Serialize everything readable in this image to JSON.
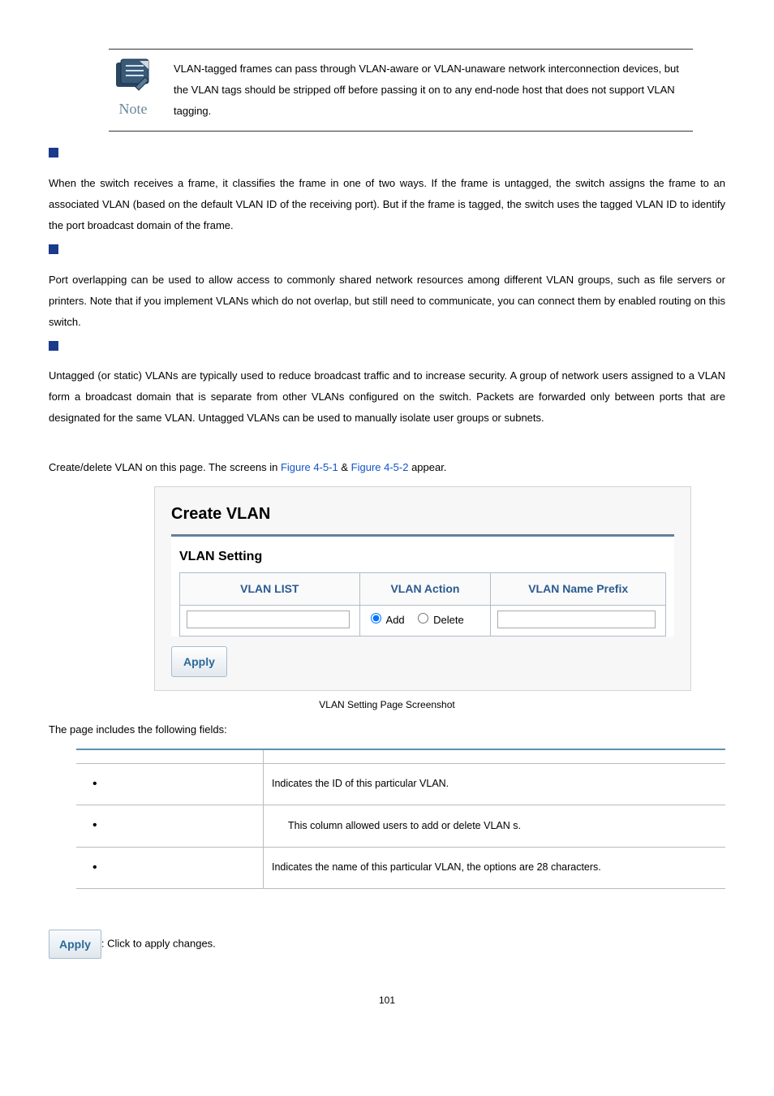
{
  "note": {
    "label": "Note",
    "text": "VLAN-tagged frames can pass through VLAN-aware or VLAN-unaware network interconnection devices, but the VLAN tags should be stripped off before passing it on to any end-node host that does not support VLAN tagging."
  },
  "section1": {
    "text": "When the switch receives a frame, it classifies the frame in one of two ways. If the frame is untagged, the switch assigns the frame to an associated VLAN (based on the default VLAN ID of the receiving port). But if the frame is tagged, the switch uses the tagged VLAN ID to identify the port broadcast domain of the frame."
  },
  "section2": {
    "text": "Port overlapping can be used to allow access to commonly shared network resources among different VLAN groups, such as file servers or printers. Note that if you implement VLANs which do not overlap, but still need to communicate, you can connect them by enabled routing on this switch."
  },
  "section3": {
    "text": "Untagged (or static) VLANs are typically used to reduce broadcast traffic and to increase security. A group of network users assigned to a VLAN form a broadcast domain that is separate from other VLANs configured on the switch. Packets are forwarded only between ports that are designated for the same VLAN. Untagged VLANs can be used to manually isolate user groups or subnets."
  },
  "intro_line_1": "Create/delete VLAN on this page. The screens in ",
  "fig_ref_1": "Figure 4-5-1",
  "amp": " & ",
  "fig_ref_2": "Figure 4-5-2",
  "intro_line_2": " appear.",
  "screenshot": {
    "title": "Create VLAN",
    "setting_legend": "VLAN Setting",
    "headers": {
      "list": "VLAN LIST",
      "action": "VLAN Action",
      "prefix": "VLAN Name Prefix"
    },
    "radio_add": "Add",
    "radio_delete": "Delete",
    "apply": "Apply"
  },
  "fig_caption": " VLAN Setting Page Screenshot",
  "fields_intro": "The page includes the following fields:",
  "fields_table": {
    "rows": [
      {
        "object": "",
        "desc": "Indicates the ID of this particular VLAN."
      },
      {
        "object": "",
        "desc": "This column allowed users to add or delete VLAN s."
      },
      {
        "object": "",
        "desc": "Indicates the name of this particular VLAN, the options are 28 characters."
      }
    ]
  },
  "buttons_inline": {
    "apply": "Apply",
    "caption": ": Click to apply changes."
  },
  "page_number": "101"
}
